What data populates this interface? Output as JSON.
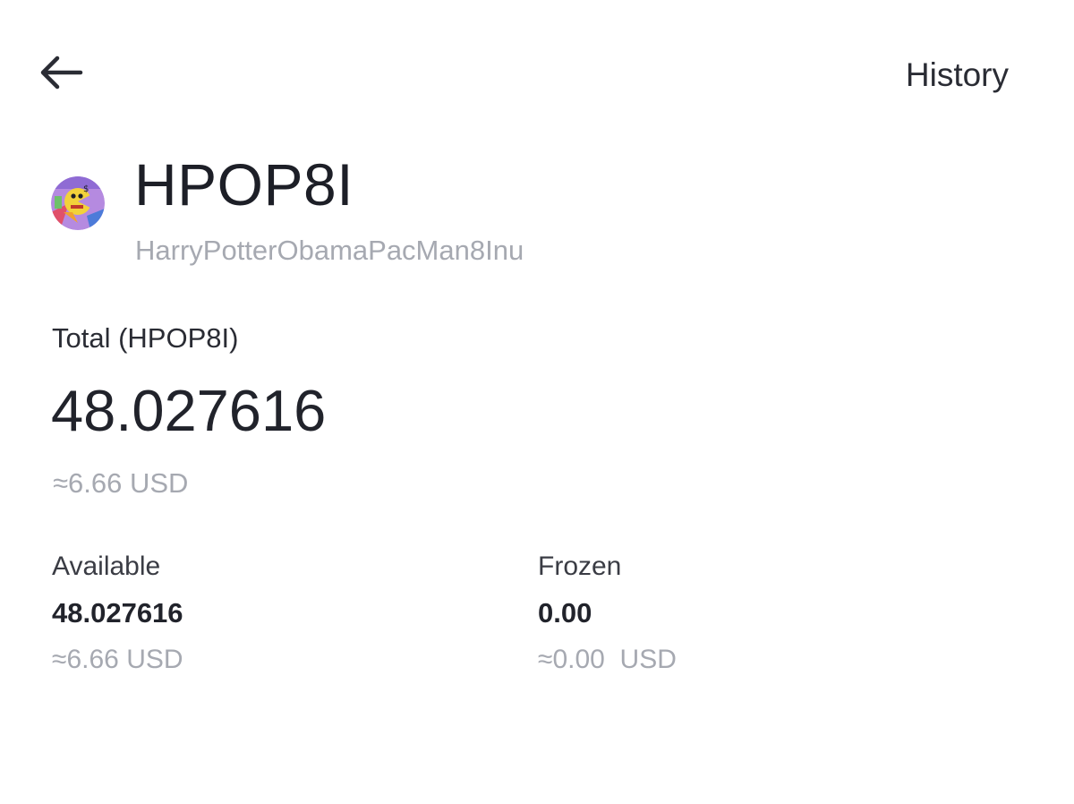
{
  "header": {
    "back_icon": "arrow-left-icon",
    "history_label": "History"
  },
  "token": {
    "symbol": "HPOP8I",
    "name": "HarryPotterObamaPacMan8Inu",
    "avatar_icon": "token-logo-icon"
  },
  "total": {
    "label": "Total (HPOP8I)",
    "amount": "48.027616",
    "usd": "≈6.66 USD"
  },
  "available": {
    "label": "Available",
    "amount": "48.027616",
    "usd": "≈6.66 USD"
  },
  "frozen": {
    "label": "Frozen",
    "amount": "0.00",
    "usd": "≈0.00  USD"
  },
  "colors": {
    "text_primary": "#21232b",
    "text_secondary": "#a6a9b1",
    "background": "#ffffff"
  }
}
